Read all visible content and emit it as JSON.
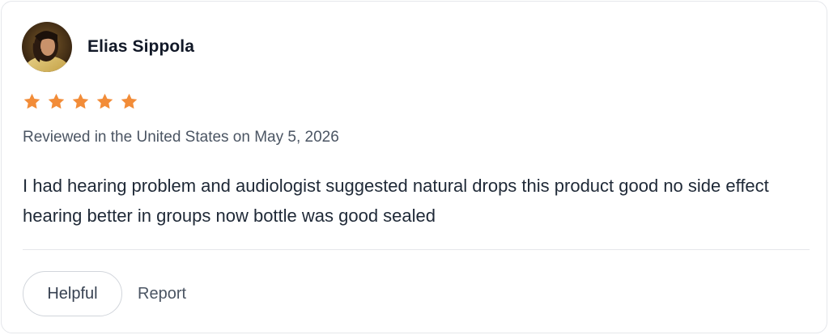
{
  "review": {
    "reviewer_name": "Elias Sippola",
    "rating": 5,
    "max_rating": 5,
    "star_color": "#f28c38",
    "meta": "Reviewed in the United States on May 5, 2026",
    "text": "I had hearing problem and audiologist suggested natural drops this product good no side effect hearing better in groups now bottle was good sealed"
  },
  "actions": {
    "helpful_label": "Helpful",
    "report_label": "Report"
  },
  "icons": {
    "avatar": "user-avatar-photo",
    "star": "star-icon"
  }
}
